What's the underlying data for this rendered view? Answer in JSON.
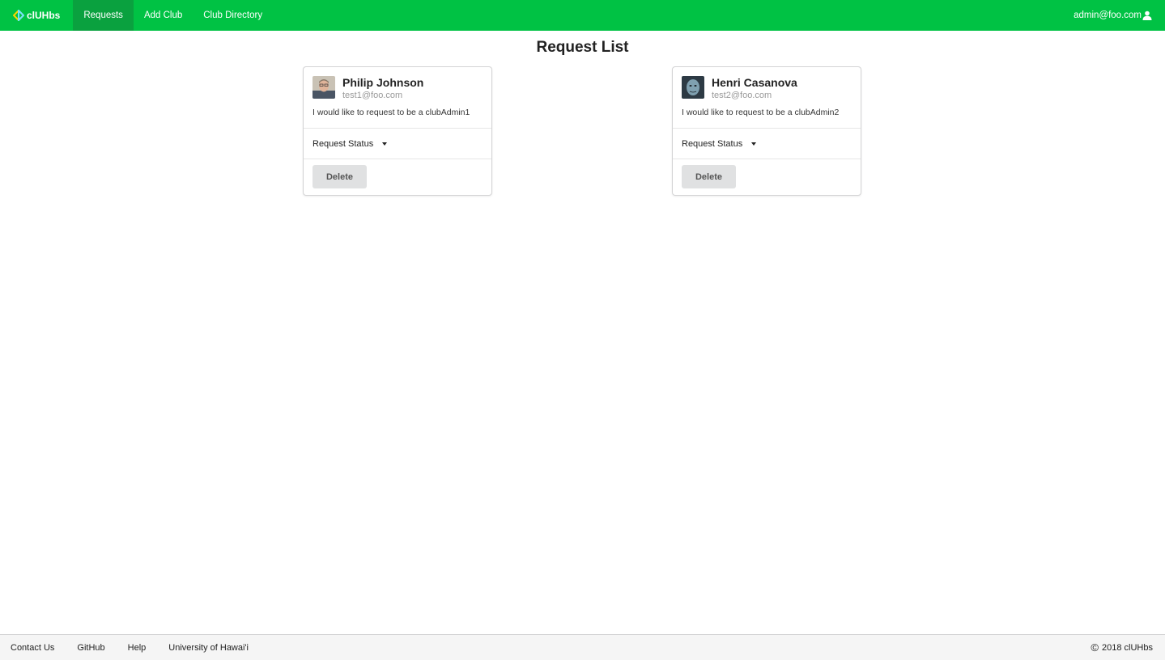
{
  "nav": {
    "brand": "clUHbs",
    "items": [
      {
        "label": "Requests",
        "active": true
      },
      {
        "label": "Add Club",
        "active": false
      },
      {
        "label": "Club Directory",
        "active": false
      }
    ],
    "user_email": "admin@foo.com"
  },
  "page_title": "Request List",
  "requests": [
    {
      "name": "Philip Johnson",
      "email": "test1@foo.com",
      "description": "I would like to request to be a clubAdmin1",
      "status_label": "Request Status",
      "delete_label": "Delete"
    },
    {
      "name": "Henri Casanova",
      "email": "test2@foo.com",
      "description": "I would like to request to be a clubAdmin2",
      "status_label": "Request Status",
      "delete_label": "Delete"
    }
  ],
  "footer": {
    "links": [
      "Contact Us",
      "GitHub",
      "Help",
      "University of Hawai'i"
    ],
    "copyright_symbol": "©",
    "copyright": "2018 clUHbs"
  },
  "colors": {
    "primary_green": "#00c244",
    "active_green": "#0aa13f"
  },
  "icons": {
    "brand": "diamond-logo-icon",
    "user": "user-icon",
    "caret": "caret-down-icon"
  }
}
